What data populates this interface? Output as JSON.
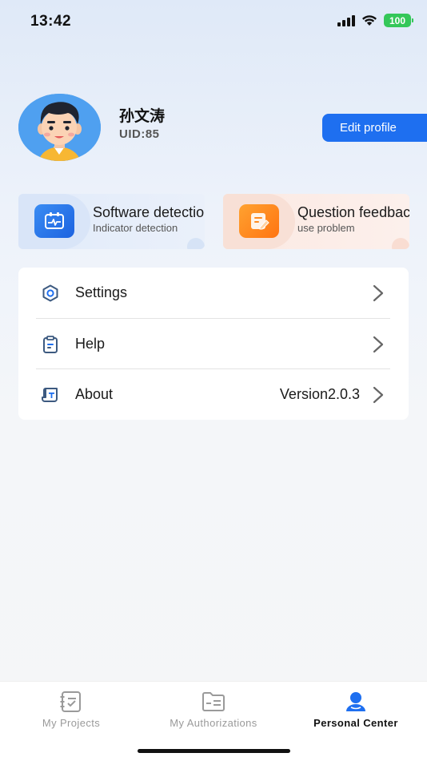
{
  "status_bar": {
    "time": "13:42",
    "battery": "100",
    "icons": [
      "signal-icon",
      "wifi-icon",
      "battery-icon"
    ]
  },
  "profile": {
    "name": "孙文涛",
    "uid": "UID:85",
    "edit_button": "Edit profile",
    "avatar_icon": "avatar-cartoon-man"
  },
  "cards": [
    {
      "title": "Software detection",
      "subtitle": "Indicator detection",
      "icon": "monitor-pulse-icon",
      "color": "#1e6ff0"
    },
    {
      "title": "Question feedback",
      "subtitle": "use problem",
      "icon": "edit-note-icon",
      "color": "#ff8a1f"
    }
  ],
  "menu": {
    "items": [
      {
        "label": "Settings",
        "value": "",
        "icon": "settings-hexagon-icon"
      },
      {
        "label": "Help",
        "value": "",
        "icon": "clipboard-icon"
      },
      {
        "label": "About",
        "value": "Version2.0.3",
        "icon": "scroll-icon"
      }
    ]
  },
  "tabbar": {
    "tabs": [
      {
        "label": "My Projects",
        "icon": "project-list-icon",
        "active": false
      },
      {
        "label": "My Authorizations",
        "icon": "folder-auth-icon",
        "active": false
      },
      {
        "label": "Personal Center",
        "icon": "user-icon",
        "active": true
      }
    ]
  },
  "colors": {
    "accent": "#1e6ff0",
    "active_tab": "#1e6ff0",
    "inactive_tab": "#9a9a9a"
  }
}
